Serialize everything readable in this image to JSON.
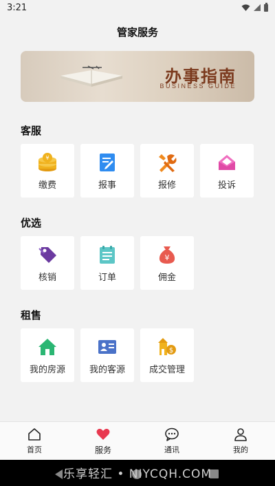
{
  "status_bar": {
    "time": "3:21"
  },
  "page": {
    "title": "管家服务"
  },
  "banner": {
    "title": "办事指南",
    "subtitle": "BUSINESS GUIDE"
  },
  "sections": [
    {
      "title": "客服",
      "items": [
        {
          "label": "缴费",
          "icon": "coins-icon"
        },
        {
          "label": "报事",
          "icon": "edit-note-icon"
        },
        {
          "label": "报修",
          "icon": "tools-icon"
        },
        {
          "label": "投诉",
          "icon": "envelope-icon"
        }
      ]
    },
    {
      "title": "优选",
      "items": [
        {
          "label": "核销",
          "icon": "tag-icon"
        },
        {
          "label": "订单",
          "icon": "notepad-icon"
        },
        {
          "label": "佣金",
          "icon": "money-bag-icon"
        }
      ]
    },
    {
      "title": "租售",
      "items": [
        {
          "label": "我的房源",
          "icon": "house-icon"
        },
        {
          "label": "我的客源",
          "icon": "id-card-icon"
        },
        {
          "label": "成交管理",
          "icon": "deal-house-icon"
        }
      ]
    }
  ],
  "bottom_nav": [
    {
      "label": "首页",
      "icon": "home-outline-icon"
    },
    {
      "label": "服务",
      "icon": "heart-icon",
      "active": true
    },
    {
      "label": "通讯",
      "icon": "chat-bubble-icon"
    },
    {
      "label": "我的",
      "icon": "person-icon"
    }
  ],
  "watermark": "乐享轻汇 • NIYCQH.COM",
  "colors": {
    "coin": "#f0b21e",
    "blue": "#2f8cf0",
    "orange": "#f08a1e",
    "pink": "#e04aa6",
    "purple": "#6b3aa0",
    "teal": "#5cc6c6",
    "red": "#e85a4f",
    "green": "#2bb673",
    "heart": "#e8384f",
    "banner_text": "#7b3a1e"
  }
}
